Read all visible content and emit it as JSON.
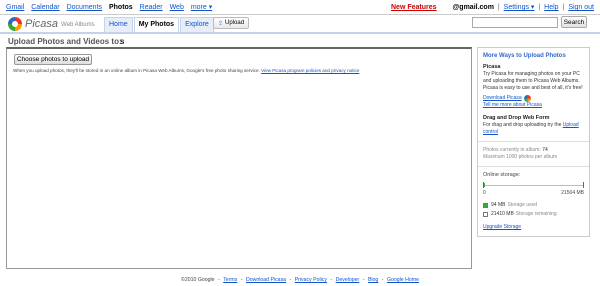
{
  "gbar": {
    "links": [
      "Gmail",
      "Calendar",
      "Documents",
      "Photos",
      "Reader",
      "Web",
      "more ▾"
    ],
    "active_link": "Photos",
    "new_features": "New Features",
    "email": "@gmail.com",
    "settings": "Settings ▾",
    "help": "Help",
    "sign_out": "Sign out",
    "sep": "|"
  },
  "header": {
    "logo_text": "Picasa",
    "logo_sub": "Web Albums",
    "tabs": [
      "Home",
      "My Photos",
      "Explore"
    ],
    "active_tab": "My Photos",
    "upload_label": "Upload",
    "search_placeholder": "",
    "search_label": "Search"
  },
  "page": {
    "title": "Upload Photos and Videos to:",
    "album_name": "s"
  },
  "main": {
    "choose_label": "Choose photos to upload",
    "notice_text": "When you upload photos, they'll be stored in an online album in Picasa Web Albums, Google's free photo sharing service.",
    "notice_link": "View Picasa program policies and privacy notice"
  },
  "sidebar": {
    "more_ways_title": "More Ways to Upload Photos",
    "picasa_title": "Picasa",
    "picasa_desc": "Try Picasa for managing photos on your PC and uploading them to Picasa Web Albums. Picasa is easy to use and best of all, it's free!",
    "download_label": "Download Picasa",
    "tell_more_label": "Tell me more about Picasa",
    "dnd_title": "Drag and Drop Web Form",
    "dnd_desc": "For drag and drop uploading try the",
    "dnd_link": "Upload control",
    "photos_count_label": "Photos currently in album:",
    "photos_count": "74",
    "max_photos": "Maximum 1000 photos per album",
    "storage_title": "Online storage:",
    "storage_min": "0",
    "storage_max": "21504 MB",
    "used_text": "94 MB",
    "used_label": "Storage used",
    "remaining_text": "21410 MB",
    "remaining_label": "Storage remaining",
    "used_fraction": 0.0044,
    "upgrade_label": "Upgrade Storage"
  },
  "footer": {
    "copyright": "©2010 Google",
    "links": [
      "Terms",
      "Download Picasa",
      "Privacy Policy",
      "Developer",
      "Blog",
      "Google Home"
    ],
    "sep": "-"
  },
  "colors": {
    "link": "#1155cc",
    "new_features": "#cc0000",
    "used": "#33aa33",
    "section_head": "#3366cc"
  }
}
